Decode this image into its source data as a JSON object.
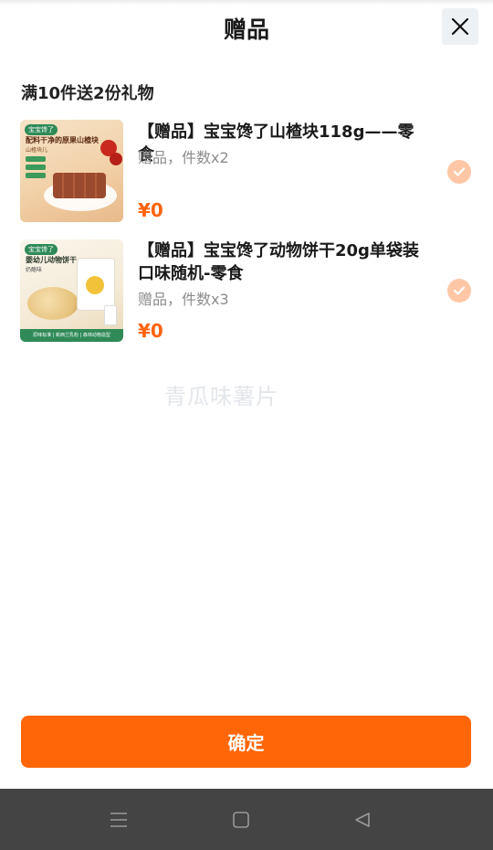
{
  "header": {
    "title": "赠品",
    "close_icon": "close-icon"
  },
  "promo": {
    "text": "满10件送2份礼物"
  },
  "items": [
    {
      "name": "【赠品】宝宝馋了山楂块118g——零食",
      "meta": "赠品，件数x2",
      "price": "¥0",
      "checked": true,
      "thumb": {
        "badge": "宝宝馋了",
        "headline": "配料干净的原果山楂块",
        "sub": "山楂块儿"
      }
    },
    {
      "name": "【赠品】宝宝馋了动物饼干20g单袋装口味随机-零食",
      "meta": "赠品，件数x3",
      "price": "¥0",
      "checked": true,
      "thumb": {
        "badge": "宝宝馋了",
        "headline": "婴幼儿动物饼干",
        "sub": "奶酪味",
        "footer": "原味标准 | 新西兰乳粉 | 森林动物造型"
      }
    }
  ],
  "watermark": {
    "text": "青瓜味薯片"
  },
  "footer": {
    "confirm_label": "确定"
  },
  "system_nav": {
    "menu_icon": "menu-icon",
    "home_icon": "home-square-icon",
    "back_icon": "back-triangle-icon"
  },
  "colors": {
    "accent": "#ff6608",
    "price": "#ff6410",
    "check_bg": "#ffc7a6",
    "navbar": "#444444"
  }
}
